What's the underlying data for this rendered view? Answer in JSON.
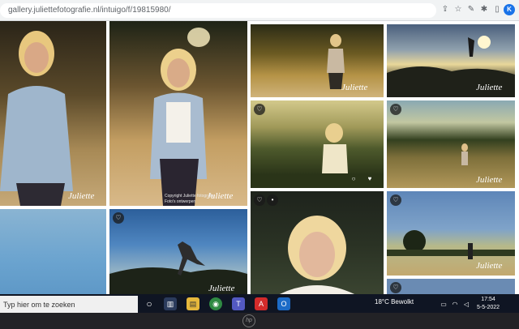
{
  "browser": {
    "url": "gallery.juliettefotografie.nl/intuigo/f/19815980/",
    "icons": [
      "grid-icon",
      "zoom-icon",
      "edit-icon",
      "puzzle-icon",
      "pin-icon",
      "star-icon",
      "profile-icon",
      "menu-icon"
    ],
    "profile_initial": "K"
  },
  "gallery": {
    "watermark": "Juliette",
    "watermark_sub": "Copyright Juliette fotografie",
    "watermark_sub2": "Foto's ontwerpen",
    "heart_glyph": "♡",
    "comment_glyph": "💬"
  },
  "taskbar": {
    "search_placeholder": "Typ hier om te zoeken",
    "start_glyph": "○",
    "weather": "18°C Bewolkt",
    "time": "17:54",
    "date": "5-5-2022",
    "apps": [
      "task-view-icon",
      "file-explorer-icon",
      "chrome-icon",
      "teams-icon",
      "acrobat-icon",
      "outlook-icon"
    ]
  },
  "device": {
    "brand": "hp"
  }
}
